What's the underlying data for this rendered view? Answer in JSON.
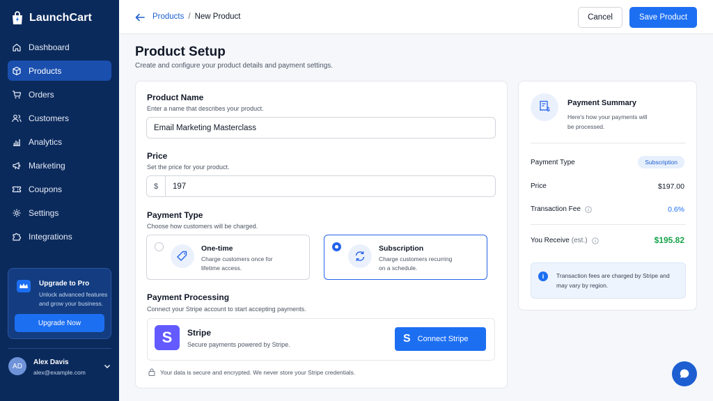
{
  "app": {
    "name": "LaunchCart"
  },
  "sidebar": {
    "items": [
      {
        "label": "Dashboard",
        "icon": "home-icon"
      },
      {
        "label": "Products",
        "icon": "box-icon",
        "active": true
      },
      {
        "label": "Orders",
        "icon": "cart-icon"
      },
      {
        "label": "Customers",
        "icon": "users-icon"
      },
      {
        "label": "Analytics",
        "icon": "bar-chart-icon"
      },
      {
        "label": "Marketing",
        "icon": "megaphone-icon"
      },
      {
        "label": "Coupons",
        "icon": "ticket-icon"
      },
      {
        "label": "Settings",
        "icon": "gear-icon"
      },
      {
        "label": "Integrations",
        "icon": "puzzle-icon"
      }
    ],
    "upgrade": {
      "title": "Upgrade to Pro",
      "text": "Unlock advanced features and grow your business.",
      "button": "Upgrade Now"
    },
    "user": {
      "initials": "AD",
      "name": "Alex Davis",
      "email": "alex@example.com"
    }
  },
  "topbar": {
    "breadcrumb": {
      "parent": "Products",
      "separator": "/",
      "current": "New Product"
    },
    "cancel_label": "Cancel",
    "save_label": "Save Product"
  },
  "page": {
    "title": "Product Setup",
    "subtitle": "Create and configure your product details and payment settings."
  },
  "form": {
    "name": {
      "label": "Product Name",
      "hint": "Enter a name that describes your product.",
      "value": "Email Marketing Masterclass"
    },
    "price": {
      "label": "Price",
      "hint": "Set the price for your product.",
      "currency": "$",
      "value": "197"
    },
    "payment_type": {
      "label": "Payment Type",
      "hint": "Choose how customers will be charged.",
      "options": [
        {
          "title": "One-time",
          "desc": "Charge customers once for lifetime access.",
          "selected": false
        },
        {
          "title": "Subscription",
          "desc": "Charge customers recurring on a schedule.",
          "selected": true
        }
      ]
    },
    "processing": {
      "label": "Payment Processing",
      "hint": "Connect your Stripe account to start accepting payments.",
      "provider": "Stripe",
      "provider_logo": "S",
      "provider_desc": "Secure payments powered by Stripe.",
      "connect_label": "Connect Stripe",
      "secure_note": "Your data is secure and encrypted. We never store your Stripe credentials."
    }
  },
  "summary": {
    "title": "Payment Summary",
    "subtitle": "Here's how your payments will be processed.",
    "payment_type_label": "Payment Type",
    "payment_type_value": "Subscription",
    "price_label": "Price",
    "price_value": "$197.00",
    "fee_label": "Transaction Fee",
    "fee_value": "0.6%",
    "receive_label": "You Receive",
    "receive_est": "(est.)",
    "receive_value": "$195.82",
    "notice": "Transaction fees are charged by Stripe and may vary by region."
  },
  "colors": {
    "sidebar": "#0b2a5c",
    "primary": "#1d6ff2",
    "stripe": "#635bff",
    "success": "#16a34a"
  }
}
